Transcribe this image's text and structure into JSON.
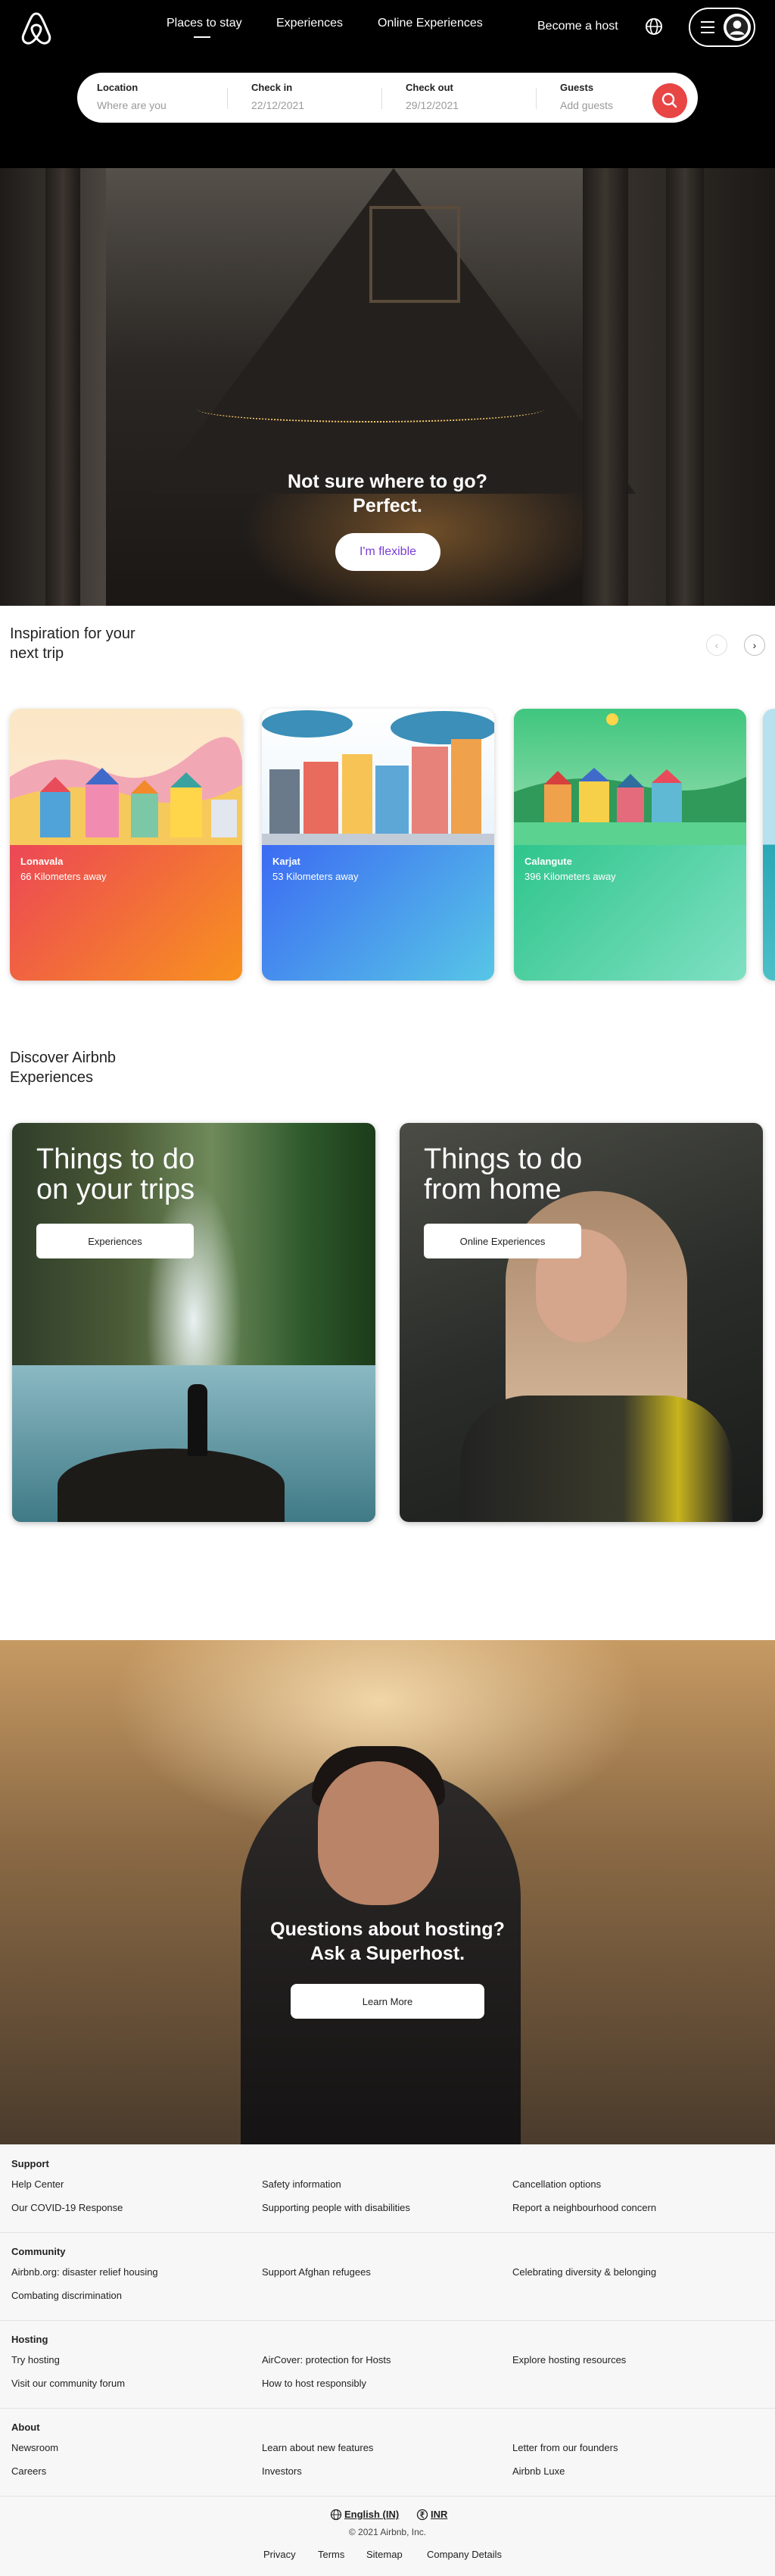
{
  "header": {
    "nav": [
      "Places to stay",
      "Experiences",
      "Online Experiences"
    ],
    "become_host": "Become a host"
  },
  "search": {
    "location_label": "Location",
    "location_placeholder": "Where are you",
    "checkin_label": "Check in",
    "checkin_value": "22/12/2021",
    "checkout_label": "Check out",
    "checkout_value": "29/12/2021",
    "guests_label": "Guests",
    "guests_placeholder": "Add guests"
  },
  "hero": {
    "title_line1": "Not sure where to go?",
    "title_line2": "Perfect.",
    "button": "I'm flexible"
  },
  "inspiration": {
    "title_line1": "Inspiration for your",
    "title_line2": "next trip",
    "prev": "‹",
    "next": "›",
    "cards": [
      {
        "name": "Lonavala",
        "distance": "66 Kilometers away",
        "color1": "#ec4756",
        "color2": "#f8921e"
      },
      {
        "name": "Karjat",
        "distance": "53 Kilometers away",
        "color1": "#3c6bf3",
        "color2": "#57c6e6"
      },
      {
        "name": "Calangute",
        "distance": "396 Kilometers away",
        "color1": "#2fc58c",
        "color2": "#7fe0c2"
      }
    ]
  },
  "discover": {
    "title_line1": "Discover Airbnb",
    "title_line2": "Experiences",
    "cards": [
      {
        "title_line1": "Things to do",
        "title_line2": "on your trips",
        "button": "Experiences"
      },
      {
        "title_line1": "Things to do",
        "title_line2": "from home",
        "button": "Online Experiences"
      }
    ]
  },
  "hosting": {
    "title_line1": "Questions about hosting?",
    "title_line2": "Ask a Superhost.",
    "button": "Learn More"
  },
  "footer": {
    "sections": [
      {
        "heading": "Support",
        "links": [
          "Help Center",
          "Safety information",
          "Cancellation options",
          "Our COVID-19 Response",
          "Supporting people with disabilities",
          "Report a neighbourhood concern"
        ]
      },
      {
        "heading": "Community",
        "links": [
          "Airbnb.org: disaster relief housing",
          "Support Afghan refugees",
          "Celebrating diversity & belonging",
          "Combating discrimination"
        ]
      },
      {
        "heading": "Hosting",
        "links": [
          "Try hosting",
          "AirCover: protection for Hosts",
          "Explore hosting resources",
          "Visit our community forum",
          "How to host responsibly"
        ]
      },
      {
        "heading": "About",
        "links": [
          "Newsroom",
          "Learn about new features",
          "Letter from our founders",
          "Careers",
          "Investors",
          "Airbnb Luxe"
        ]
      }
    ],
    "language": "English (IN)",
    "currency": "INR",
    "copyright": "© 2021 Airbnb, Inc.",
    "bottom_links": [
      "Privacy",
      "Terms",
      "Sitemap",
      "Company Details"
    ]
  }
}
